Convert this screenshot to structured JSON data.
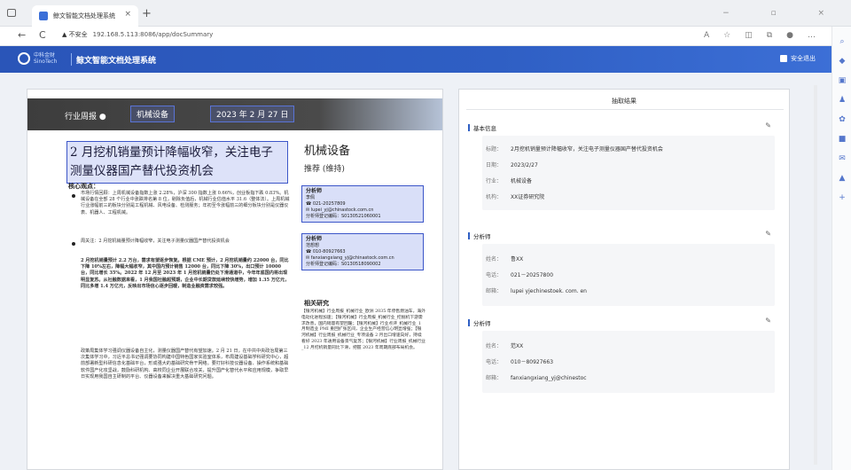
{
  "browser": {
    "tab_title": "鲸文智能文档处理系统",
    "tab_close": "×",
    "new_tab": "+",
    "window_controls": "− ▫ ×",
    "nav": {
      "back": "←",
      "reload": "C"
    },
    "address": {
      "security_text": "▲ 不安全",
      "url": "192.168.5.113:8086/app/docSummary"
    }
  },
  "app": {
    "logo_text_cn": "中科金财",
    "logo_text_en": "SinoTech",
    "title": "鲸文智能文档处理系统",
    "logout_label": "安全退出"
  },
  "document": {
    "header_label": "行业周报 ●",
    "header_sector": "机械设备",
    "header_date": "2023 年 2 月 27 日",
    "title": "2 月挖机销量预计降幅收窄，关注电子测量仪器国产替代投资机会",
    "sector": "机械设备",
    "rating": "推荐 (维持)",
    "core_label": "核心观点：",
    "para1": "市场行情回顾：上周机械设备指数上涨 2.28%，沪深 300 指数上涨 0.66%，创业板指下跌 0.83%。机械设备在全部 28 个行业中涨跌排名第 8 位，剔除负值后，机械行业估值水平 31.6（整体法）。上周机械行业涨幅前三的板块分别是工程机械、风电设备、检测服务；年初至今涨幅前三的细分板块分别是仪器仪表、机器人、工程机械。",
    "para2": "周关注：2 月挖机销量预计降幅收窄，关注电子测量仪器国产替代投资机会",
    "para3": "2 月挖机销量预计 2.2 万台，需求有望逐步恢复。根据 CME 预计，2 月挖机销量约 22000 台，同比下降 10%左右，降幅大幅收窄，其中国内预计销售 12000 台，同比下降 30%，出口预计 10000 台，同比增长 35%。2022 年 12 月至 2023 年 1 月挖机销量仍处下滑通道中，今年年底国内将出现明显复苏。从社融数据来看，1 月我国社融超预期，企业中长期贷款延续较快增势，增加 1.35 万亿元，同比多增 1.4 万亿元，反映出市场信心逐步回暖，制造业融资需求较强。",
    "para4": "政策局集体学习强调仪器设备自主化，测量仪器国产替代有望加速。2 月 21 日，在中共中央政治局第三次集体学习中，习近平总书记强调要协同构建中国特色国家实验室体系，布局建设基础学科研究中心，超前部署新型科研信息化基础平台，形成强大的基础研究骨干网络。要打好科技仪器设备、操作系统和基础软件国产化攻坚战，鼓励科研机构、高校同企业开展联合攻关，提升国产化替代水平和应用规模，争取早日实现用我国自主研制的平台、仪器设备来解决重大基础研究问题。",
    "analysts": [
      {
        "heading": "分析师",
        "name": "李佩",
        "phone": "☎ 021-20257809",
        "email": "✉ lupei_yj@chinastock.com.cn",
        "cert": "分析师登记编码：S0130521060001"
      },
      {
        "heading": "分析师",
        "name": "范想想",
        "phone": "☎ 010-80927663",
        "email": "✉ fanxiangxiang_yj@chinastock.com.cn",
        "cert": "分析师登记编码：S0130518090002"
      }
    ],
    "related_heading": "相关研究",
    "related": "【银河机械】行业周报_机械行业_欧洲 2035 年停售燃油车，海外电动化进程加速；【银河机械】行业周报_机械行业_挖掘机下游需求改善，国内销量有望回暖；【银河机械】行业点评_机械行业_1 月制造业 PMI 重回扩张区间，企业生产经营信心明显增强；【银河机械】行业周报_机械行业_专项设备 2 月出口增速向好，持续看好 2023 年通用设备景气复苏；【银河机械】行业周报_机械行业_12 月挖机销量同比下滑，把握 2023 年周期底部布局机会。"
  },
  "panel": {
    "title": "抽取结果",
    "sections": [
      {
        "title": "基本信息",
        "rows": [
          {
            "label": "标题：",
            "value": "2月挖机销量预计降幅收窄，关注电子测量仪器国产替代投资机会"
          },
          {
            "label": "日期：",
            "value": "2023/2/27"
          },
          {
            "label": "行业：",
            "value": "机械设备"
          },
          {
            "label": "机构：",
            "value": "XX证券研究院"
          }
        ]
      },
      {
        "title": "分析师",
        "rows": [
          {
            "label": "姓名：",
            "value": "鲁XX"
          },
          {
            "label": "电话：",
            "value": "021－20257800"
          },
          {
            "label": "邮箱：",
            "value": "lupei yjechinestoek. com. en"
          }
        ]
      },
      {
        "title": "分析师",
        "rows": [
          {
            "label": "姓名：",
            "value": "范XX"
          },
          {
            "label": "电话：",
            "value": "010－80927663"
          },
          {
            "label": "邮箱：",
            "value": "fanxiangxiang_yj@chinestoc"
          }
        ]
      }
    ]
  }
}
